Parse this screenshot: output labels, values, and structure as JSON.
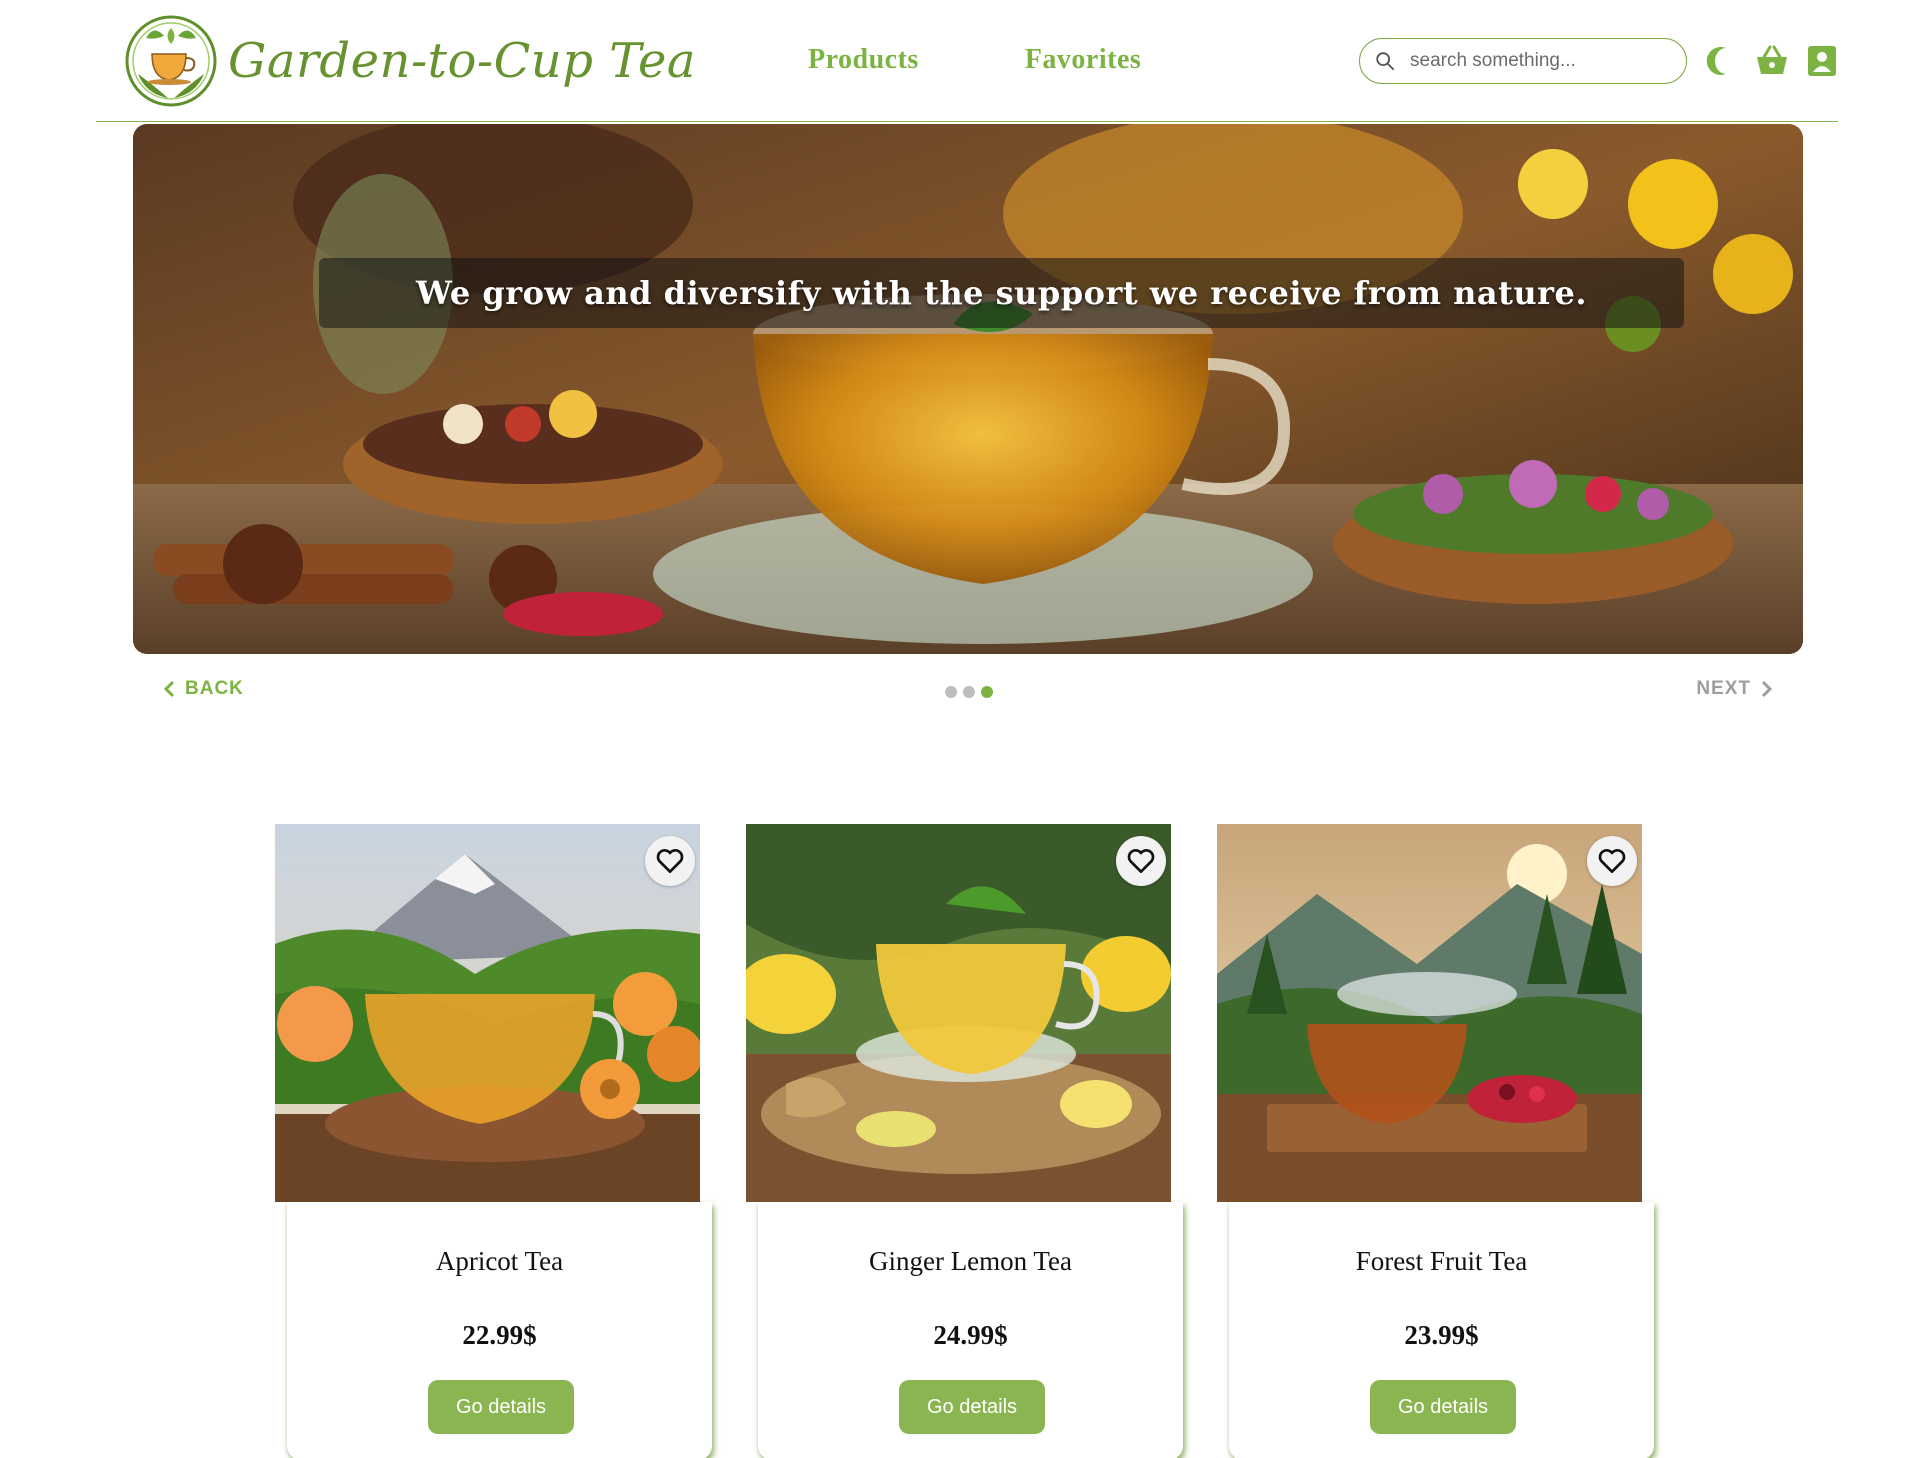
{
  "brand": {
    "name": "Garden-to-Cup Tea"
  },
  "nav": {
    "products": "Products",
    "favorites": "Favorites"
  },
  "search": {
    "placeholder": "search something..."
  },
  "header_icons": [
    "moon-icon",
    "basket-icon",
    "user-icon"
  ],
  "hero": {
    "caption": "We grow and diversify with the support we receive from nature.",
    "back_label": "BACK",
    "next_label": "NEXT",
    "slide_count": 3,
    "active_slide": 3
  },
  "products": [
    {
      "name": "Apricot Tea",
      "price": "22.99$",
      "button": "Go details"
    },
    {
      "name": "Ginger Lemon Tea",
      "price": "24.99$",
      "button": "Go details"
    },
    {
      "name": "Forest Fruit Tea",
      "price": "23.99$",
      "button": "Go details"
    }
  ],
  "colors": {
    "accent": "#7cb342",
    "button": "#8ab550",
    "muted": "#9e9e9e",
    "border": "#8bb050"
  }
}
